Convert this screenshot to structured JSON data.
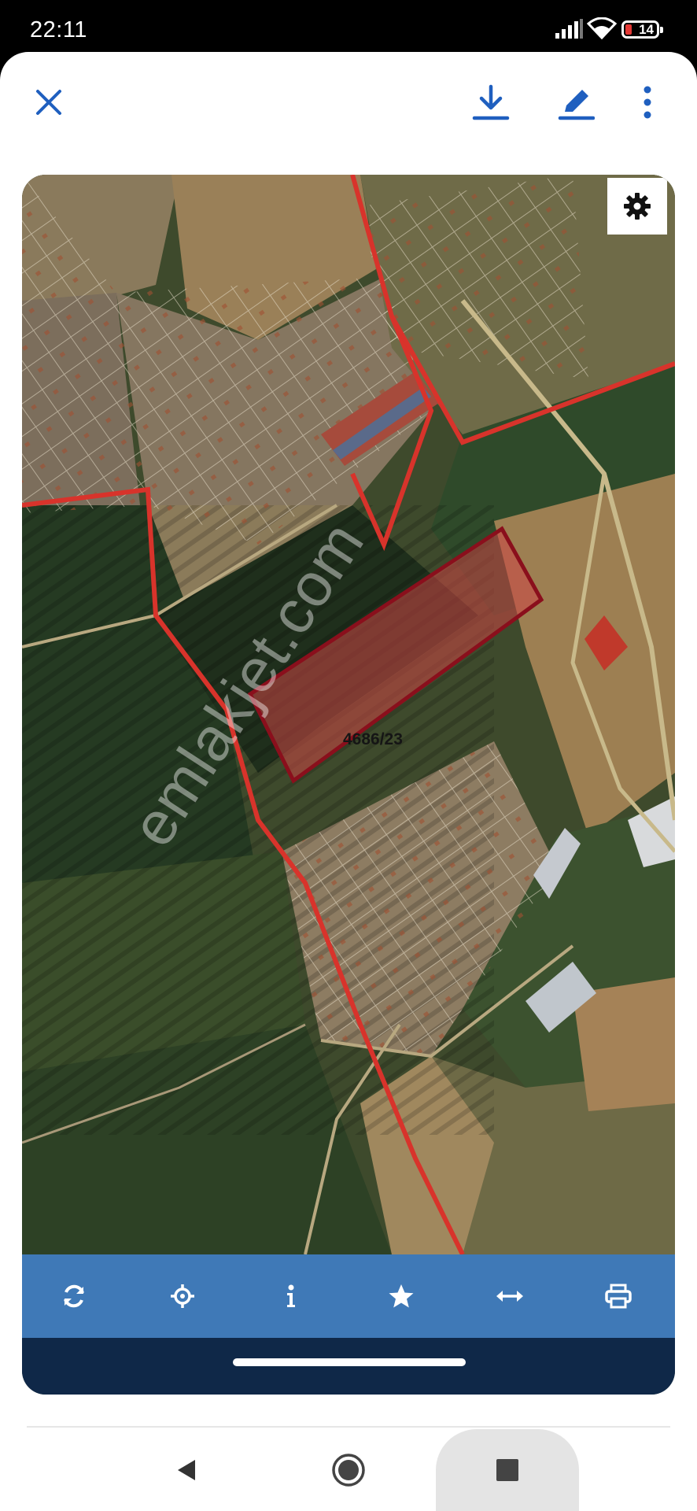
{
  "status_bar": {
    "time": "22:11",
    "battery_level": "14",
    "icons": [
      "signal-icon",
      "wifi-icon",
      "battery-icon"
    ]
  },
  "toolbar": {
    "icons": [
      "close-icon",
      "download-icon",
      "edit-icon",
      "more-vertical-icon"
    ],
    "accent_color": "#1f5fbf"
  },
  "map": {
    "parcel_label": "4686/23",
    "watermark": "emlakjet.com",
    "settings_icon": "gear-icon",
    "boundary_color": "#d8332b",
    "parcel_outline_color": "#8a0f1c"
  },
  "map_toolbar": {
    "background_color": "#3f79b7",
    "icons": [
      "refresh-icon",
      "locate-icon",
      "info-icon",
      "star-icon",
      "measure-icon",
      "print-icon"
    ]
  },
  "nav_bar": {
    "icons": [
      "back-icon",
      "home-icon",
      "recents-icon"
    ]
  }
}
